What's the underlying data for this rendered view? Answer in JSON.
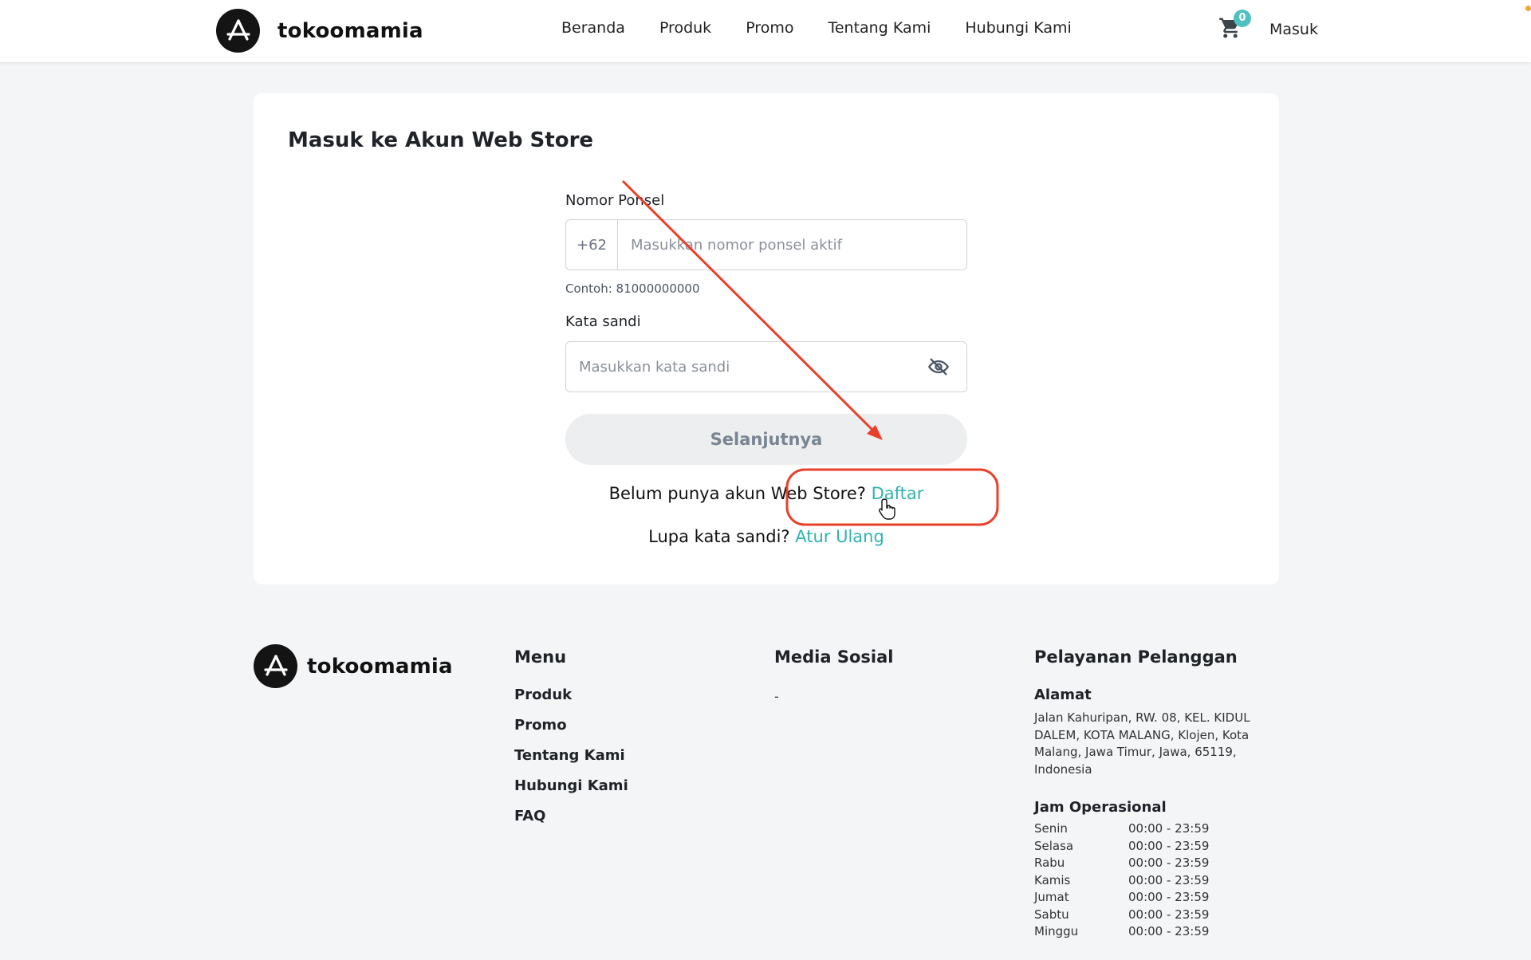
{
  "brand": {
    "name": "tokoomamia"
  },
  "nav": {
    "items": [
      "Beranda",
      "Produk",
      "Promo",
      "Tentang Kami",
      "Hubungi Kami"
    ],
    "cart_count": "0",
    "login": "Masuk"
  },
  "login_card": {
    "title": "Masuk ke Akun Web Store",
    "phone": {
      "label": "Nomor Ponsel",
      "prefix": "+62",
      "placeholder": "Masukkan nomor ponsel aktif",
      "hint": "Contoh: 81000000000"
    },
    "password": {
      "label": "Kata sandi",
      "placeholder": "Masukkan kata sandi"
    },
    "submit_label": "Selanjutnya",
    "register_prompt": "Belum punya akun Web Store?",
    "register_link": "Daftar",
    "forgot_prompt": "Lupa kata sandi?",
    "reset_link": "Atur Ulang"
  },
  "footer": {
    "brand_name": "tokoomamia",
    "menu": {
      "title": "Menu",
      "items": [
        "Produk",
        "Promo",
        "Tentang Kami",
        "Hubungi Kami",
        "FAQ"
      ]
    },
    "social": {
      "title": "Media Sosial",
      "value": "-"
    },
    "service": {
      "title": "Pelayanan Pelanggan",
      "address_title": "Alamat",
      "address": "Jalan Kahuripan, RW. 08, KEL. KIDUL DALEM, KOTA MALANG, Klojen, Kota Malang, Jawa Timur, Jawa, 65119, Indonesia",
      "hours_title": "Jam Operasional",
      "hours": [
        {
          "day": "Senin",
          "time": "00:00 - 23:59"
        },
        {
          "day": "Selasa",
          "time": "00:00 - 23:59"
        },
        {
          "day": "Rabu",
          "time": "00:00 - 23:59"
        },
        {
          "day": "Kamis",
          "time": "00:00 - 23:59"
        },
        {
          "day": "Jumat",
          "time": "00:00 - 23:59"
        },
        {
          "day": "Sabtu",
          "time": "00:00 - 23:59"
        },
        {
          "day": "Minggu",
          "time": "00:00 - 23:59"
        }
      ]
    }
  },
  "colors": {
    "accent": "#2fb3b0",
    "badge": "#4fc1c0",
    "annotation": "#e8402a"
  }
}
